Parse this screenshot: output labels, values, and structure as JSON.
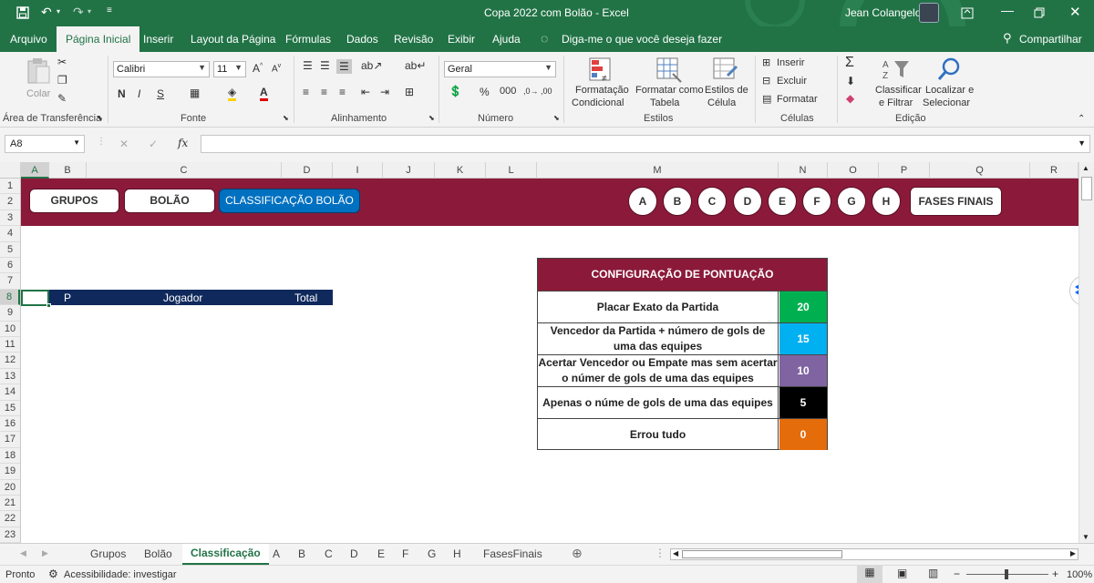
{
  "title_bar": {
    "title": "Copa 2022 com Bolão  -  Excel",
    "user": "Jean Colangelo"
  },
  "menu": {
    "tabs": [
      "Arquivo",
      "Página Inicial",
      "Inserir",
      "Layout da Página",
      "Fórmulas",
      "Dados",
      "Revisão",
      "Exibir",
      "Ajuda"
    ],
    "active": "Página Inicial",
    "tell_me": "Diga-me o que você deseja fazer",
    "share": "Compartilhar"
  },
  "ribbon": {
    "paste": "Colar",
    "clipboard": "Área de Transferência",
    "font_name": "Calibri",
    "font_size": "11",
    "font_group": "Fonte",
    "alignment_group": "Alinhamento",
    "number_format": "Geral",
    "number_group": "Número",
    "cond_format_1": "Formatação",
    "cond_format_2": "Condicional",
    "format_table_1": "Formatar como",
    "format_table_2": "Tabela",
    "cell_styles_1": "Estilos de",
    "cell_styles_2": "Célula",
    "styles_group": "Estilos",
    "insert": "Inserir",
    "delete": "Excluir",
    "format": "Formatar",
    "cells_group": "Células",
    "sort_1": "Classificar",
    "sort_2": "e Filtrar",
    "find_1": "Localizar e",
    "find_2": "Selecionar",
    "editing_group": "Edição"
  },
  "formula_bar": {
    "name_box": "A8",
    "fx": "fx",
    "content": ""
  },
  "columns": [
    "A",
    "B",
    "C",
    "D",
    "I",
    "J",
    "K",
    "L",
    "M",
    "N",
    "O",
    "P",
    "Q",
    "R"
  ],
  "rows": [
    "1",
    "2",
    "3",
    "4",
    "5",
    "6",
    "7",
    "8",
    "9",
    "10",
    "11",
    "12",
    "13",
    "14",
    "15",
    "16",
    "17",
    "18",
    "19",
    "20",
    "21",
    "22",
    "23"
  ],
  "nav_buttons": {
    "grupos": "GRUPOS",
    "bolao": "BOLÃO",
    "classificacao": "CLASSIFICAÇÃO BOLÃO",
    "groups": [
      "A",
      "B",
      "C",
      "D",
      "E",
      "F",
      "G",
      "H"
    ],
    "fases": "FASES FINAIS"
  },
  "ranking_header": {
    "p": "P",
    "jogador": "Jogador",
    "total": "Total"
  },
  "scoring": {
    "title": "CONFIGURAÇÃO DE PONTUAÇÃO",
    "rows": [
      {
        "label": "Placar Exato da Partida",
        "value": "20"
      },
      {
        "label": "Vencedor da Partida + número de gols de uma das equipes",
        "value": "15"
      },
      {
        "label": "Acertar Vencedor ou Empate mas sem acertar o númer de gols de uma das equipes",
        "value": "10"
      },
      {
        "label": "Apenas o núme de gols de uma das equipes",
        "value": "5"
      },
      {
        "label": "Errou tudo",
        "value": "0"
      }
    ],
    "colors": [
      "#00b050",
      "#00b0f0",
      "#8064a2",
      "#000000",
      "#e46c0a"
    ],
    "title_color": "#8b1a3a"
  },
  "sheet_tabs": {
    "tabs": [
      "Grupos",
      "Bolão",
      "Classificação",
      "A",
      "B",
      "C",
      "D",
      "E",
      "F",
      "G",
      "H",
      "FasesFinais"
    ],
    "active": "Classificação"
  },
  "status": {
    "ready": "Pronto",
    "accessibility": "Acessibilidade: investigar",
    "zoom": "100%"
  },
  "colors": {
    "excel_green": "#217346",
    "band": "#8b1a3a",
    "header_navy": "#10295c",
    "active_button": "#0070c0"
  }
}
